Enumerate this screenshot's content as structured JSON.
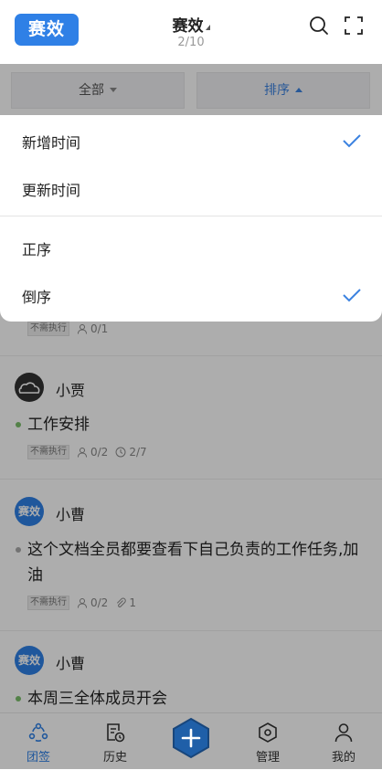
{
  "header": {
    "logo_text": "赛效",
    "title": "赛效",
    "subtitle": "2/10"
  },
  "filters": {
    "all_label": "全部",
    "sort_label": "排序"
  },
  "sort_menu": {
    "items": [
      {
        "label": "新增时间",
        "checked": true
      },
      {
        "label": "更新时间",
        "checked": false
      },
      {
        "label": "正序",
        "checked": false
      },
      {
        "label": "倒序",
        "checked": true
      }
    ]
  },
  "feed": {
    "partial_meta": {
      "tag": "不需执行",
      "people": "0/1"
    },
    "posts": [
      {
        "user": "小贾",
        "avatar": "cloud-icon",
        "dot_color": "#7bbf6a",
        "title": "工作安排",
        "tag": "不需执行",
        "people": "0/2",
        "time": "2/7"
      },
      {
        "user": "小曹",
        "avatar_text": "赛效",
        "dot_color": "#aaaaaa",
        "title": "这个文档全员都要查看下自己负责的工作任务,加油",
        "tag": "不需执行",
        "people": "0/2",
        "attach": "1"
      },
      {
        "user": "小曹",
        "avatar_text": "赛效",
        "dot_color": "#7bbf6a",
        "title": "本周三全体成员开会"
      }
    ]
  },
  "tabbar": {
    "items": [
      {
        "label": "团签",
        "icon": "team-icon",
        "active": true
      },
      {
        "label": "历史",
        "icon": "history-icon",
        "active": false
      },
      {
        "label": "管理",
        "icon": "manage-icon",
        "active": false
      },
      {
        "label": "我的",
        "icon": "profile-icon",
        "active": false
      }
    ],
    "fab_icon": "plus-icon"
  },
  "colors": {
    "accent": "#2f80e6",
    "check": "#3b82e0",
    "overlay": "rgba(0,0,0,0.32)"
  }
}
